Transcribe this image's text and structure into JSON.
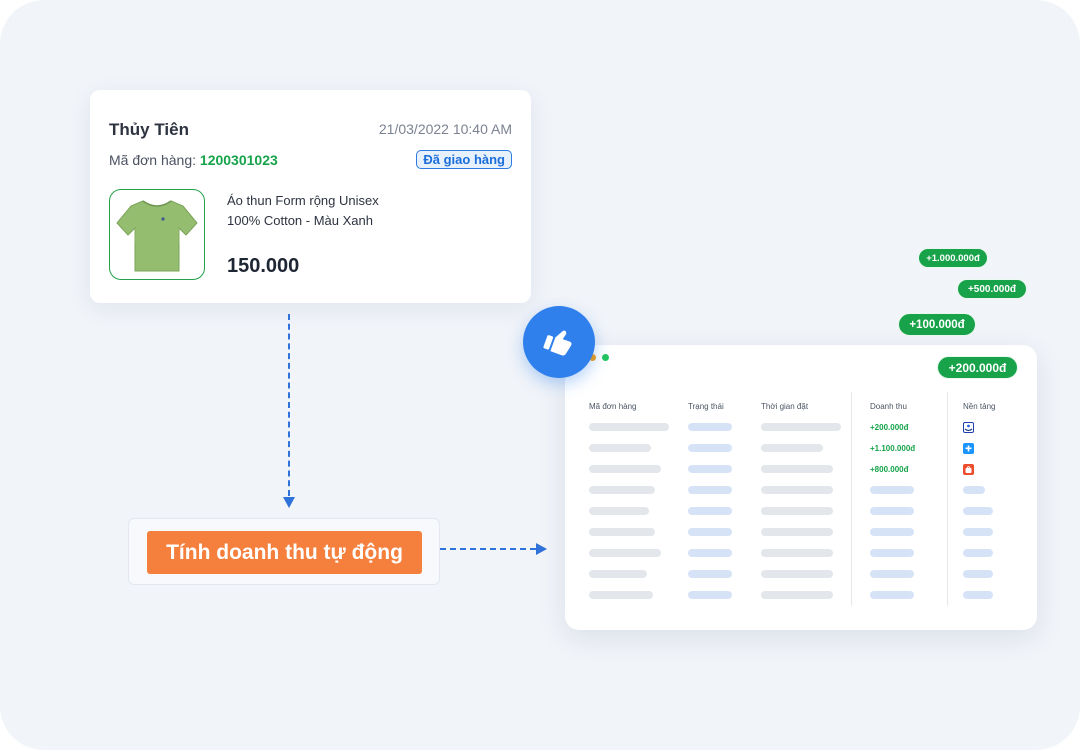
{
  "order": {
    "customer_name": "Thủy Tiên",
    "datetime": "21/03/2022 10:40 AM",
    "order_label": "Mã đơn hàng:",
    "order_id": "1200301023",
    "status": "Đã giao hàng",
    "product_line1": "Áo thun Form rộng Unisex",
    "product_line2": "100% Cotton - Màu Xanh",
    "price": "150.000"
  },
  "action": {
    "auto_revenue_label": "Tính doanh thu tự động"
  },
  "revenue_pills": [
    "+1.000.000đ",
    "+500.000đ",
    "+100.000đ",
    "+200.000đ"
  ],
  "table": {
    "columns": [
      "Mã đơn hàng",
      "Trạng thái",
      "Thời gian đặt",
      "Doanh thu",
      "Nền tảng"
    ],
    "revenue_values": [
      "+200.000đ",
      "+1.100.000đ",
      "+800.000đ"
    ],
    "platform_icons": [
      "platform-lazada-icon",
      "platform-tiki-icon",
      "platform-shopee-icon"
    ]
  },
  "colors": {
    "accent_blue": "#2f80ed",
    "success_green": "#18a34a",
    "action_orange": "#f5803e",
    "background": "#f1f4f9"
  }
}
